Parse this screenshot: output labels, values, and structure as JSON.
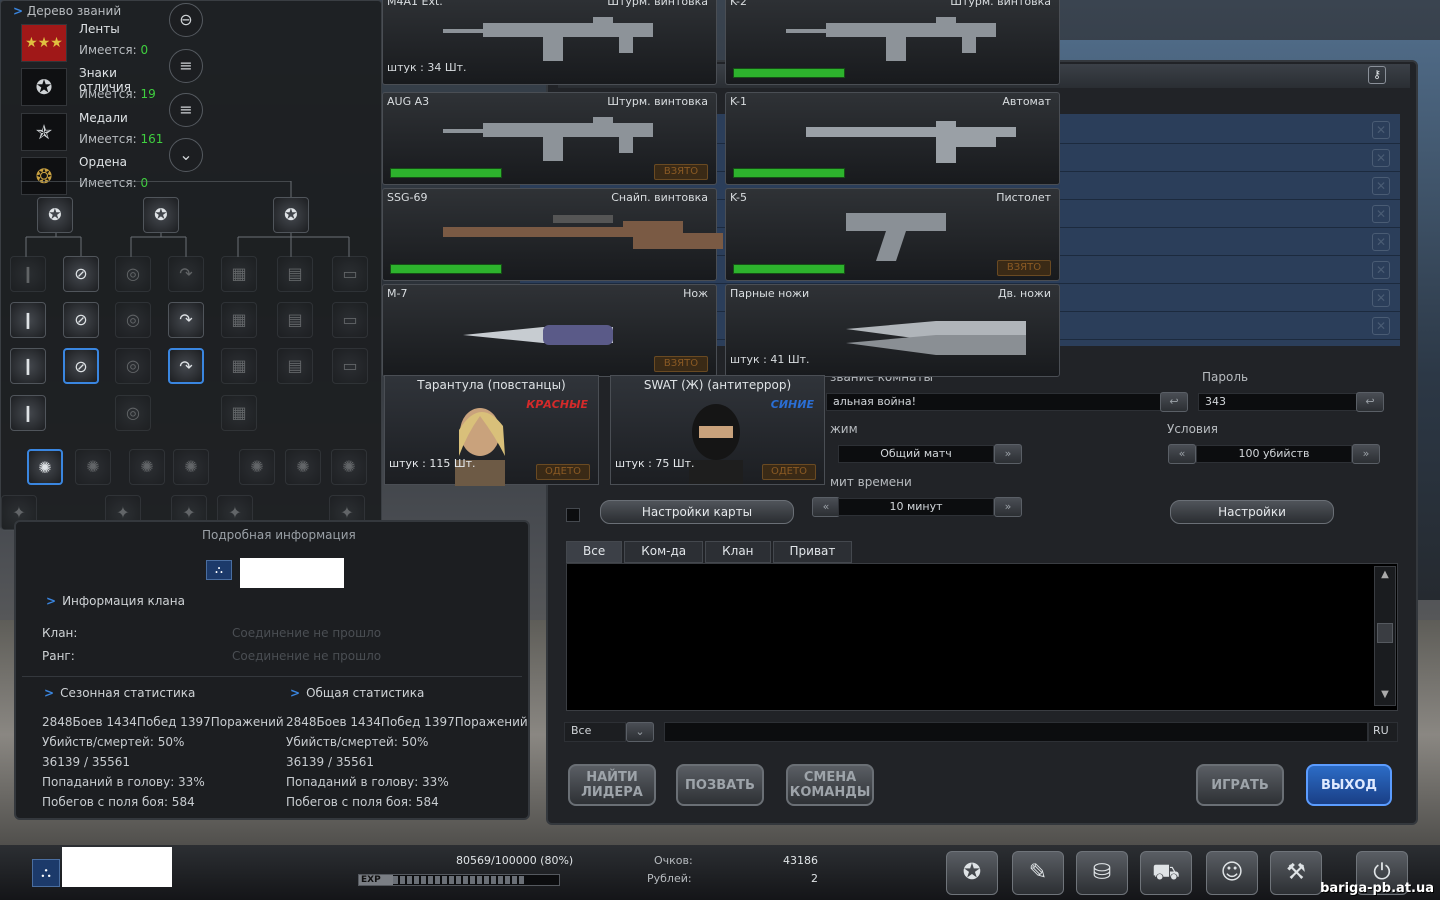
{
  "rank": {
    "title": "Дерево званий",
    "have_label": "Имеется:",
    "awards": [
      {
        "name": "Ленты",
        "count": "0"
      },
      {
        "name": "Знаки отличия",
        "count": "19"
      },
      {
        "name": "Медали",
        "count": "161"
      },
      {
        "name": "Ордена",
        "count": "0"
      }
    ]
  },
  "weapons": [
    {
      "name": "M4A1 Ext.",
      "type": "Штурм. винтовка",
      "count": "штук : 34 Шт.",
      "bar": false,
      "status": "",
      "icon": "rifle-icon"
    },
    {
      "name": "K-2",
      "type": "Штурм. винтовка",
      "count": "",
      "bar": true,
      "status": "",
      "icon": "rifle-icon"
    },
    {
      "name": "AUG A3",
      "type": "Штурм. винтовка",
      "count": "",
      "bar": true,
      "status": "ВЗЯТО",
      "icon": "rifle-icon"
    },
    {
      "name": "K-1",
      "type": "Автомат",
      "count": "",
      "bar": true,
      "status": "",
      "icon": "smg-icon"
    },
    {
      "name": "SSG-69",
      "type": "Снайп. винтовка",
      "count": "",
      "bar": true,
      "status": "",
      "icon": "sniper-icon"
    },
    {
      "name": "K-5",
      "type": "Пистолет",
      "count": "",
      "bar": true,
      "status": "ВЗЯТО",
      "icon": "pistol-icon"
    },
    {
      "name": "M-7",
      "type": "Нож",
      "count": "",
      "bar": false,
      "status": "ВЗЯТО",
      "icon": "knife-icon"
    },
    {
      "name": "Парные ножи",
      "type": "Дв. ножи",
      "count": "штук : 41 Шт.",
      "bar": false,
      "status": "",
      "icon": "dual-knife-icon"
    }
  ],
  "characters": [
    {
      "name": "Тарантула (повстанцы)",
      "team": "КРАСНЫЕ",
      "count": "штук : 115 Шт.",
      "status": "ОДЕТО"
    },
    {
      "name": "SWAT (Ж) (антитеррор)",
      "team": "СИНИЕ",
      "count": "штук : 75 Шт.",
      "status": "ОДЕТО"
    }
  ],
  "room": {
    "name_label": "звание комнаты",
    "name_value": "альная война!",
    "password_label": "Пароль",
    "password_value": "343",
    "mode_label": "жим",
    "mode_value": "Общий матч",
    "conditions_label": "Условия",
    "conditions_value": "100 убийств",
    "time_label": "мит времени",
    "time_value": "10 минут",
    "map_settings": "Настройки карты",
    "settings": "Настройки"
  },
  "chat": {
    "tabs": [
      "Все",
      "Ком-да",
      "Клан",
      "Приват"
    ],
    "channel": "Все",
    "lang": "RU"
  },
  "buttons": {
    "find_leader": "НАЙТИ ЛИДЕРА",
    "invite": "ПОЗВАТЬ",
    "change_team": "СМЕНА КОМАНДЫ",
    "play": "ИГРАТЬ",
    "exit": "ВЫХОД"
  },
  "info": {
    "title": "Подробная информация",
    "clan_heading": "Информация клана",
    "clan_label": "Клан:",
    "rank_label": "Ранг:",
    "no_connection": "Соединение не прошло",
    "season_heading": "Сезонная статистика",
    "total_heading": "Общая статистика",
    "season": [
      "2848Боев 1434Побед 1397Поражений",
      "Убийств/смертей: 50%",
      "36139 / 35561",
      "Попаданий в голову: 33%",
      "Побегов с поля боя: 584"
    ],
    "total": [
      "2848Боев 1434Побед 1397Поражений",
      "Убийств/смертей: 50%",
      "36139 / 35561",
      "Попаданий в голову: 33%",
      "Побегов с поля боя: 584"
    ]
  },
  "bottom": {
    "exp": "80569/100000 (80%)",
    "exp_label": "EXP",
    "exp_fraction": 0.8,
    "points_label": "Очков:",
    "points": "43186",
    "rubles_label": "Рублей:",
    "rubles": "2"
  },
  "watermark": "bariga-pb.at.ua",
  "colors": {
    "accent": "#3a86e0",
    "green_bar": "#2db32d",
    "red_team": "#d42a2a",
    "blue_team": "#2a6ed4"
  }
}
